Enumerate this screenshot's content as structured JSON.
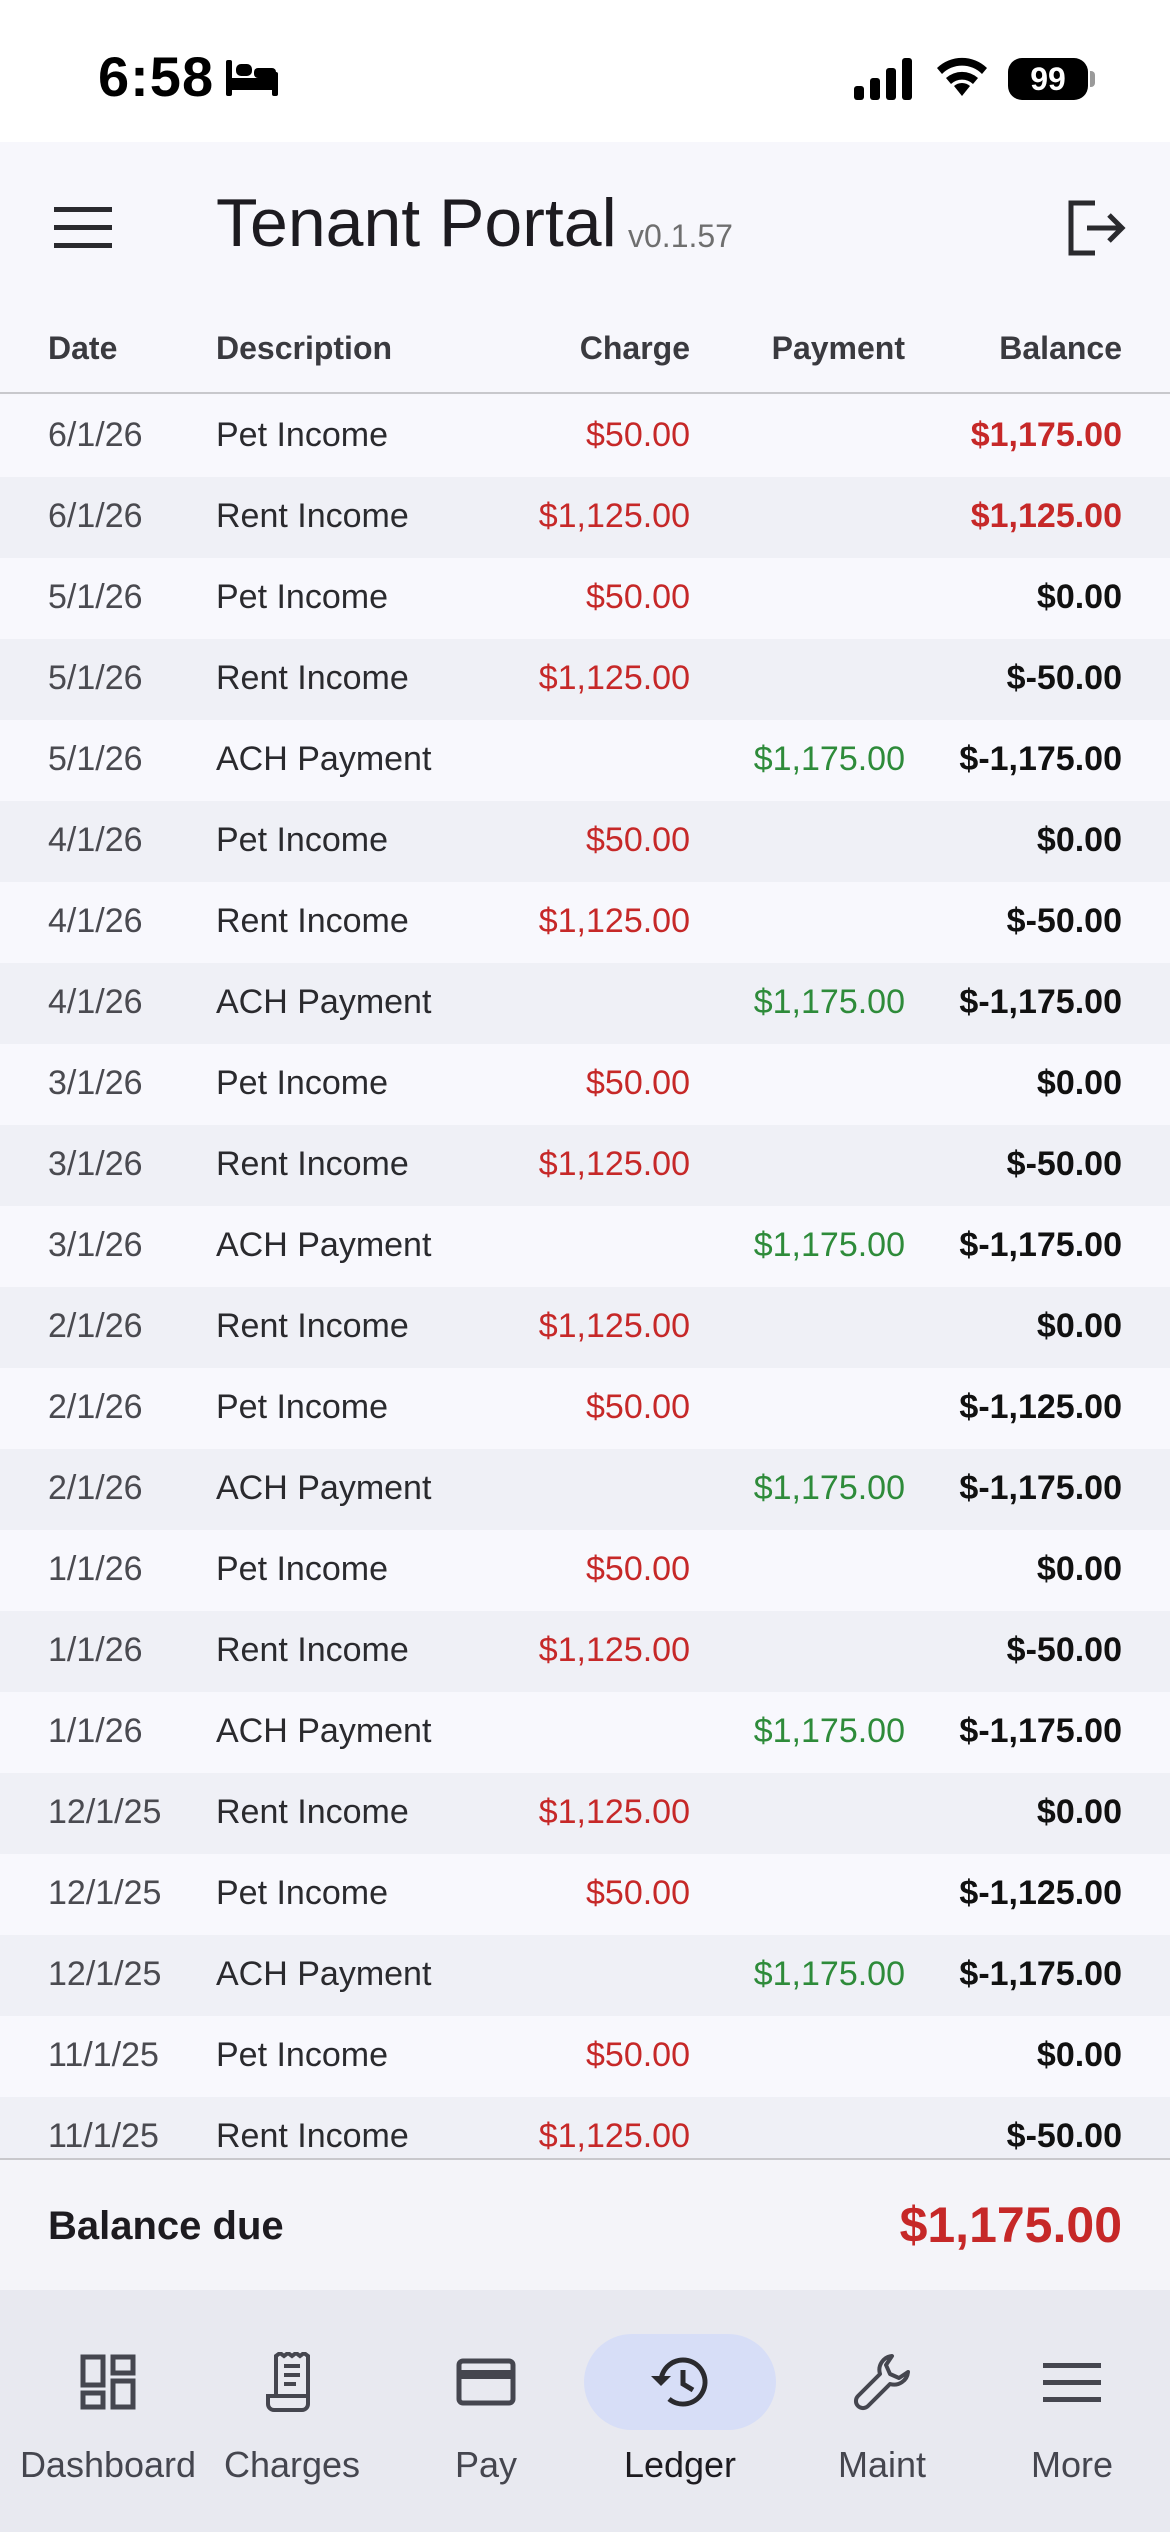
{
  "status_bar": {
    "time": "6:58",
    "battery": "99",
    "icons": [
      "bed-icon",
      "signal-icon",
      "wifi-icon",
      "battery-icon"
    ]
  },
  "app_bar": {
    "title": "Tenant Portal",
    "version": "v0.1.57",
    "icons": [
      "menu-icon",
      "logout-icon"
    ]
  },
  "table": {
    "headers": {
      "date": "Date",
      "description": "Description",
      "charge": "Charge",
      "payment": "Payment",
      "balance": "Balance"
    },
    "rows": [
      {
        "date": "6/1/26",
        "description": "Pet Income",
        "charge": "$50.00",
        "payment": "",
        "balance": "$1,175.00"
      },
      {
        "date": "6/1/26",
        "description": "Rent Income",
        "charge": "$1,125.00",
        "payment": "",
        "balance": "$1,125.00"
      },
      {
        "date": "5/1/26",
        "description": "Pet Income",
        "charge": "$50.00",
        "payment": "",
        "balance": "$0.00"
      },
      {
        "date": "5/1/26",
        "description": "Rent Income",
        "charge": "$1,125.00",
        "payment": "",
        "balance": "$-50.00"
      },
      {
        "date": "5/1/26",
        "description": "ACH Payment",
        "charge": "",
        "payment": "$1,175.00",
        "balance": "$-1,175.00"
      },
      {
        "date": "4/1/26",
        "description": "Pet Income",
        "charge": "$50.00",
        "payment": "",
        "balance": "$0.00"
      },
      {
        "date": "4/1/26",
        "description": "Rent Income",
        "charge": "$1,125.00",
        "payment": "",
        "balance": "$-50.00"
      },
      {
        "date": "4/1/26",
        "description": "ACH Payment",
        "charge": "",
        "payment": "$1,175.00",
        "balance": "$-1,175.00"
      },
      {
        "date": "3/1/26",
        "description": "Pet Income",
        "charge": "$50.00",
        "payment": "",
        "balance": "$0.00"
      },
      {
        "date": "3/1/26",
        "description": "Rent Income",
        "charge": "$1,125.00",
        "payment": "",
        "balance": "$-50.00"
      },
      {
        "date": "3/1/26",
        "description": "ACH Payment",
        "charge": "",
        "payment": "$1,175.00",
        "balance": "$-1,175.00"
      },
      {
        "date": "2/1/26",
        "description": "Rent Income",
        "charge": "$1,125.00",
        "payment": "",
        "balance": "$0.00"
      },
      {
        "date": "2/1/26",
        "description": "Pet Income",
        "charge": "$50.00",
        "payment": "",
        "balance": "$-1,125.00"
      },
      {
        "date": "2/1/26",
        "description": "ACH Payment",
        "charge": "",
        "payment": "$1,175.00",
        "balance": "$-1,175.00"
      },
      {
        "date": "1/1/26",
        "description": "Pet Income",
        "charge": "$50.00",
        "payment": "",
        "balance": "$0.00"
      },
      {
        "date": "1/1/26",
        "description": "Rent Income",
        "charge": "$1,125.00",
        "payment": "",
        "balance": "$-50.00"
      },
      {
        "date": "1/1/26",
        "description": "ACH Payment",
        "charge": "",
        "payment": "$1,175.00",
        "balance": "$-1,175.00"
      },
      {
        "date": "12/1/25",
        "description": "Rent Income",
        "charge": "$1,125.00",
        "payment": "",
        "balance": "$0.00"
      },
      {
        "date": "12/1/25",
        "description": "Pet Income",
        "charge": "$50.00",
        "payment": "",
        "balance": "$-1,125.00"
      },
      {
        "date": "12/1/25",
        "description": "ACH Payment",
        "charge": "",
        "payment": "$1,175.00",
        "balance": "$-1,175.00"
      },
      {
        "date": "11/1/25",
        "description": "Pet Income",
        "charge": "$50.00",
        "payment": "",
        "balance": "$0.00"
      },
      {
        "date": "11/1/25",
        "description": "Rent Income",
        "charge": "$1,125.00",
        "payment": "",
        "balance": "$-50.00"
      }
    ]
  },
  "balance_due": {
    "label": "Balance due",
    "amount": "$1,175.00"
  },
  "bottom_nav": {
    "items": [
      {
        "label": "Dashboard",
        "icon": "dashboard-icon",
        "active": false
      },
      {
        "label": "Charges",
        "icon": "receipt-icon",
        "active": false
      },
      {
        "label": "Pay",
        "icon": "credit-card-icon",
        "active": false
      },
      {
        "label": "Ledger",
        "icon": "history-icon",
        "active": true
      },
      {
        "label": "Maint",
        "icon": "wrench-icon",
        "active": false
      },
      {
        "label": "More",
        "icon": "menu-icon",
        "active": false
      }
    ]
  },
  "colors": {
    "charge": "#c62828",
    "payment": "#2e8b3a",
    "accent_pill": "#d7def7",
    "nav_background": "#e8e9f0"
  }
}
